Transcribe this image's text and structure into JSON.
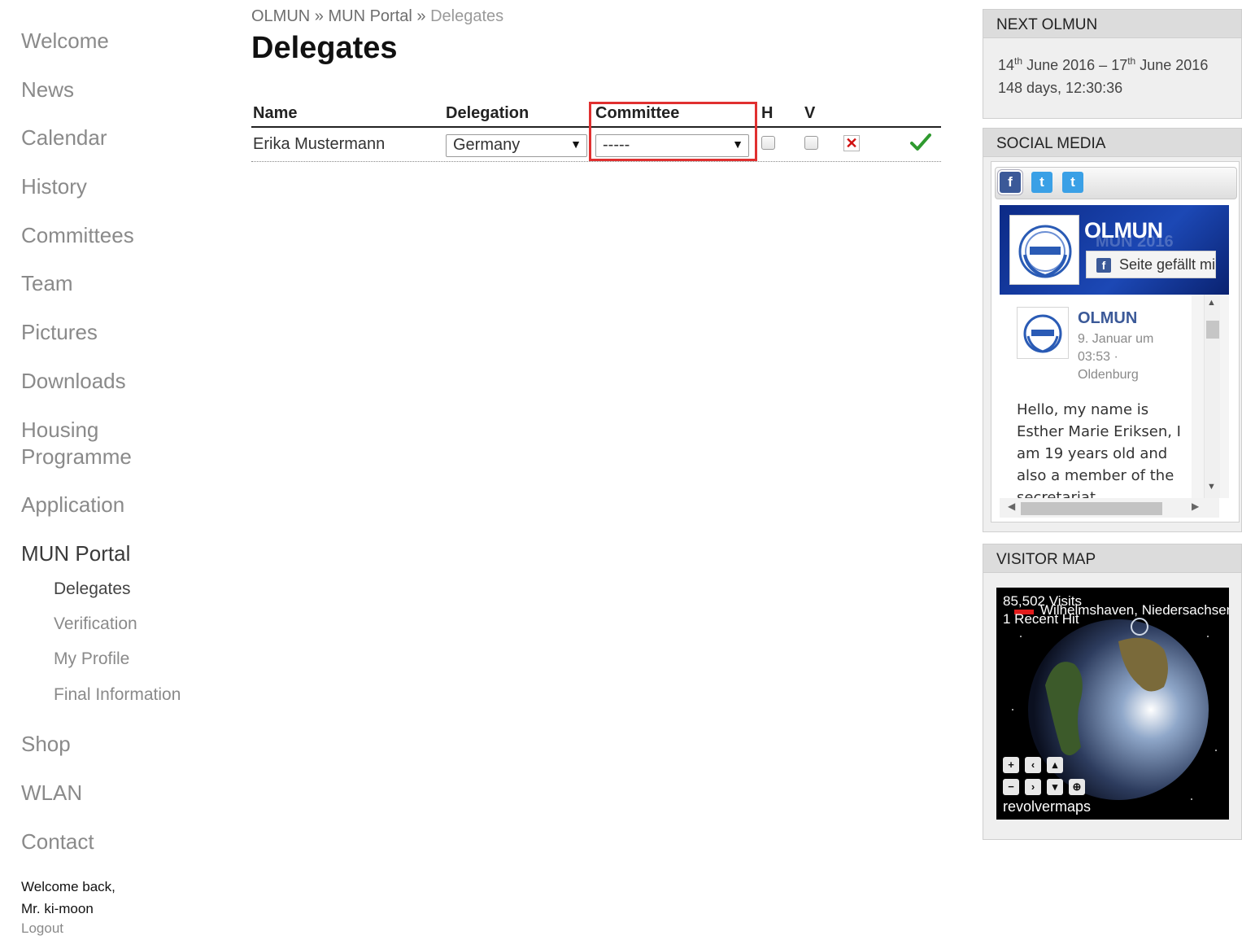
{
  "nav": {
    "items": [
      {
        "label": "Welcome"
      },
      {
        "label": "News"
      },
      {
        "label": "Calendar"
      },
      {
        "label": "History"
      },
      {
        "label": "Committees"
      },
      {
        "label": "Team"
      },
      {
        "label": "Pictures"
      },
      {
        "label": "Downloads"
      },
      {
        "label": "Housing"
      },
      {
        "label": "Programme"
      },
      {
        "label": "Application"
      },
      {
        "label": "MUN Portal"
      },
      {
        "label": "Shop"
      },
      {
        "label": "WLAN"
      },
      {
        "label": "Contact"
      }
    ],
    "sub_items": [
      {
        "label": "Delegates"
      },
      {
        "label": "Verification"
      },
      {
        "label": "My Profile"
      },
      {
        "label": "Final Information"
      }
    ],
    "welcome_line1": "Welcome back,",
    "welcome_line2": "Mr. ki-moon",
    "logout": "Logout"
  },
  "breadcrumb": {
    "items": [
      "OLMUN",
      "MUN Portal",
      "Delegates"
    ],
    "separator": "»"
  },
  "page": {
    "title": "Delegates"
  },
  "table": {
    "headers": {
      "name": "Name",
      "delegation": "Delegation",
      "committee": "Committee",
      "h": "H",
      "v": "V"
    },
    "rows": [
      {
        "name": "Erika Mustermann",
        "delegation": "Germany",
        "committee": "-----",
        "h": false,
        "v": false
      }
    ]
  },
  "sidebar": {
    "next": {
      "title": "NEXT OLMUN",
      "start_day": "14",
      "start_suffix": "th",
      "start_rest": "June 2016",
      "dash": "–",
      "end_day": "17",
      "end_suffix": "th",
      "end_rest": "June 2016",
      "countdown": "148 days, 12:30:36"
    },
    "social": {
      "title": "SOCIAL MEDIA",
      "tabs": [
        "f",
        "t",
        "t"
      ],
      "page_name": "OLMUN",
      "cover_text": "MUN 2016",
      "like_label": "Seite gefällt mir",
      "post": {
        "author": "OLMUN",
        "meta": "9. Januar um 03:53 · Oldenburg",
        "text": "Hello, my name is Esther Marie Eriksen, I am 19 years old and also a member of the secretariat"
      }
    },
    "map": {
      "title": "VISITOR MAP",
      "visits": "85,502 Visits",
      "recent": "1 Recent Hit",
      "location": "Wilhelmshaven, Niedersachsen",
      "brand": "revolvermaps"
    }
  },
  "colors": {
    "highlight": "#e03030",
    "link_blue": "#3b5998",
    "nav_text": "#8a8a8a"
  }
}
